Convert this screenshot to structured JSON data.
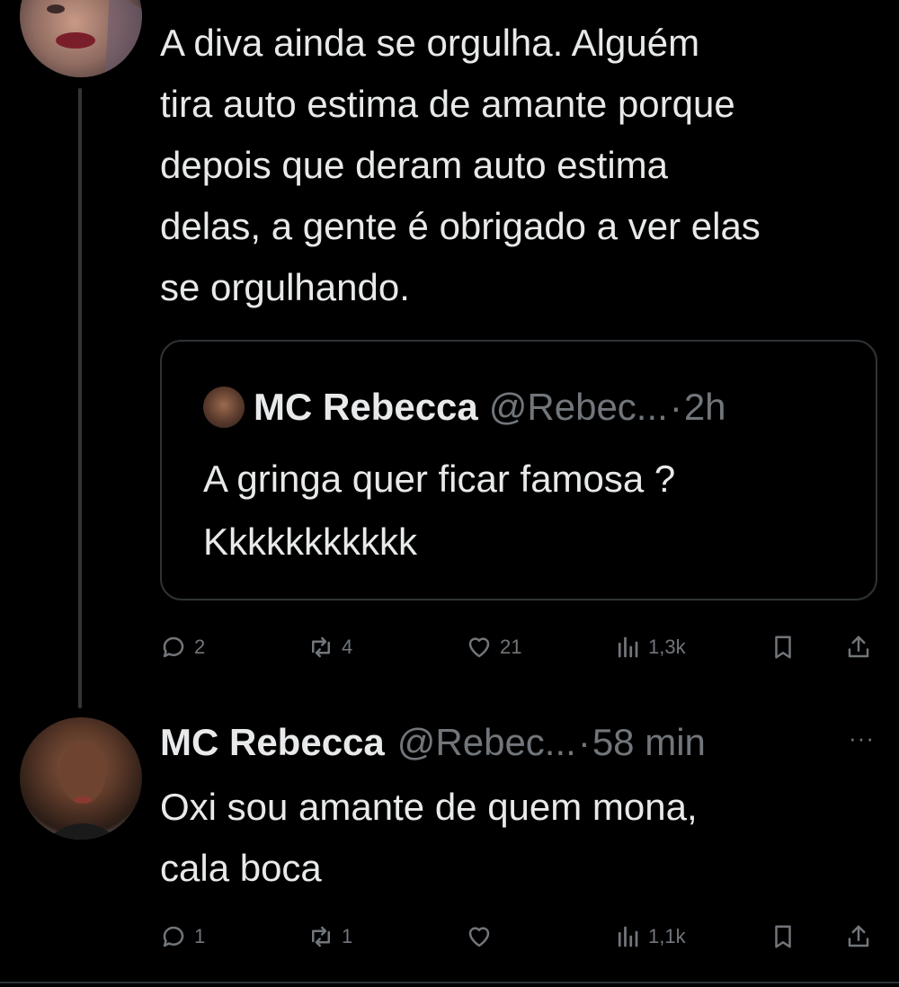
{
  "tweet1": {
    "text": "A diva ainda se orgulha. Alguém\ntira auto estima de amante porque\ndepois que deram auto estima\ndelas, a gente é obrigado a ver elas\nse orgulhando.",
    "quote": {
      "name": "MC Rebecca",
      "handle": "@Rebec...",
      "sep": "·",
      "time": "2h",
      "text": "A gringa quer ficar famosa ?\nKkkkkkkkkkk"
    },
    "actions": {
      "replies": "2",
      "retweets": "4",
      "likes": "21",
      "views": "1,3k"
    }
  },
  "tweet2": {
    "name": "MC Rebecca",
    "handle": "@Rebec...",
    "sep": "·",
    "time": "58 min",
    "more": "···",
    "text": "Oxi sou amante de quem mona,\ncala boca",
    "actions": {
      "replies": "1",
      "retweets": "1",
      "likes": "",
      "views": "1,1k"
    }
  },
  "icons": {
    "reply": "reply-icon",
    "retweet": "retweet-icon",
    "like": "heart-icon",
    "views": "views-icon",
    "bookmark": "bookmark-icon",
    "share": "share-icon"
  },
  "colors": {
    "background": "#000000",
    "text": "#e7e9ea",
    "muted": "#71767b",
    "border": "#2f3336"
  }
}
